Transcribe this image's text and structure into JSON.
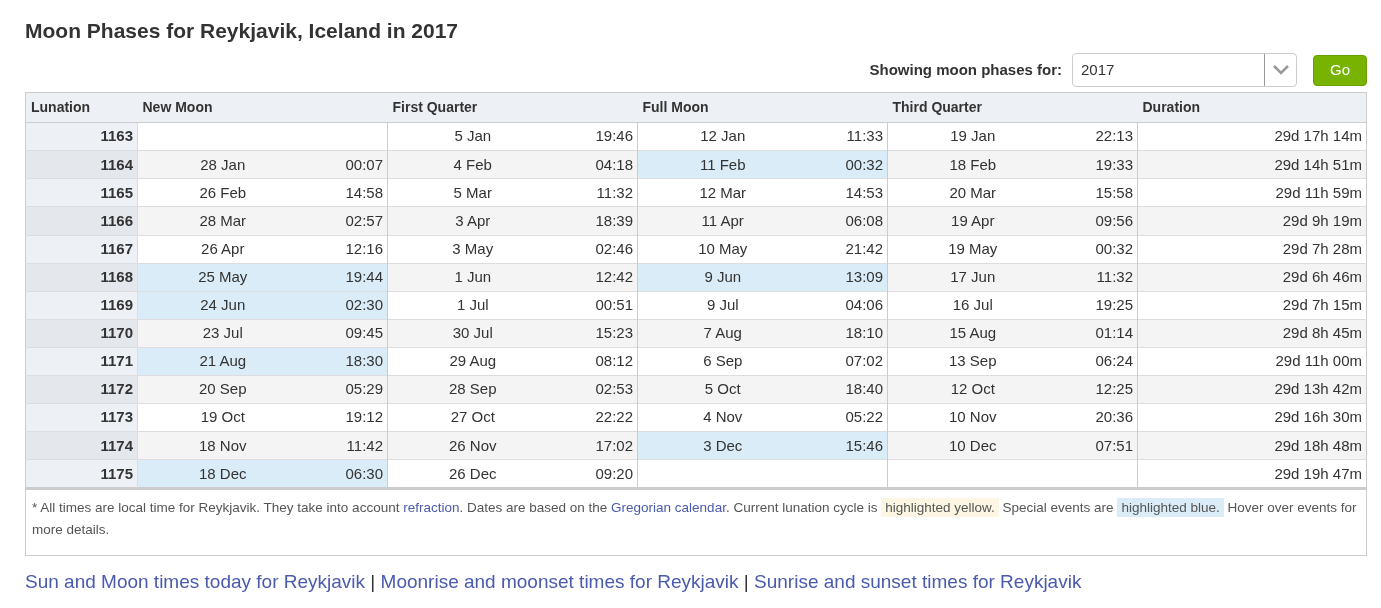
{
  "title": "Moon Phases for Reykjavik, Iceland in 2017",
  "selector": {
    "label": "Showing moon phases for:",
    "value": "2017",
    "button": "Go"
  },
  "table": {
    "columns": [
      {
        "label": "Lunation"
      },
      {
        "label": "New Moon"
      },
      {
        "label": "First Quarter"
      },
      {
        "label": "Full Moon"
      },
      {
        "label": "Third Quarter"
      },
      {
        "label": "Duration"
      }
    ],
    "rows": [
      {
        "lunation": "1163",
        "first_quarter": {
          "date": "5 Jan",
          "time": "19:46",
          "special": false
        },
        "full_moon": {
          "date": "12 Jan",
          "time": "11:33",
          "special": false
        },
        "third_quarter": {
          "date": "19 Jan",
          "time": "22:13",
          "special": false
        },
        "duration": "29d 17h 14m"
      },
      {
        "lunation": "1164",
        "new_moon": {
          "date": "28 Jan",
          "time": "00:07",
          "special": false
        },
        "first_quarter": {
          "date": "4 Feb",
          "time": "04:18",
          "special": false
        },
        "full_moon": {
          "date": "11 Feb",
          "time": "00:32",
          "special": true
        },
        "third_quarter": {
          "date": "18 Feb",
          "time": "19:33",
          "special": false
        },
        "duration": "29d 14h 51m"
      },
      {
        "lunation": "1165",
        "new_moon": {
          "date": "26 Feb",
          "time": "14:58",
          "special": false
        },
        "first_quarter": {
          "date": "5 Mar",
          "time": "11:32",
          "special": false
        },
        "full_moon": {
          "date": "12 Mar",
          "time": "14:53",
          "special": false
        },
        "third_quarter": {
          "date": "20 Mar",
          "time": "15:58",
          "special": false
        },
        "duration": "29d 11h 59m"
      },
      {
        "lunation": "1166",
        "new_moon": {
          "date": "28 Mar",
          "time": "02:57",
          "special": false
        },
        "first_quarter": {
          "date": "3 Apr",
          "time": "18:39",
          "special": false
        },
        "full_moon": {
          "date": "11 Apr",
          "time": "06:08",
          "special": false
        },
        "third_quarter": {
          "date": "19 Apr",
          "time": "09:56",
          "special": false
        },
        "duration": "29d 9h 19m"
      },
      {
        "lunation": "1167",
        "new_moon": {
          "date": "26 Apr",
          "time": "12:16",
          "special": false
        },
        "first_quarter": {
          "date": "3 May",
          "time": "02:46",
          "special": false
        },
        "full_moon": {
          "date": "10 May",
          "time": "21:42",
          "special": false
        },
        "third_quarter": {
          "date": "19 May",
          "time": "00:32",
          "special": false
        },
        "duration": "29d 7h 28m"
      },
      {
        "lunation": "1168",
        "new_moon": {
          "date": "25 May",
          "time": "19:44",
          "special": true
        },
        "first_quarter": {
          "date": "1 Jun",
          "time": "12:42",
          "special": false
        },
        "full_moon": {
          "date": "9 Jun",
          "time": "13:09",
          "special": true
        },
        "third_quarter": {
          "date": "17 Jun",
          "time": "11:32",
          "special": false
        },
        "duration": "29d 6h 46m"
      },
      {
        "lunation": "1169",
        "new_moon": {
          "date": "24 Jun",
          "time": "02:30",
          "special": true
        },
        "first_quarter": {
          "date": "1 Jul",
          "time": "00:51",
          "special": false
        },
        "full_moon": {
          "date": "9 Jul",
          "time": "04:06",
          "special": false
        },
        "third_quarter": {
          "date": "16 Jul",
          "time": "19:25",
          "special": false
        },
        "duration": "29d 7h 15m"
      },
      {
        "lunation": "1170",
        "new_moon": {
          "date": "23 Jul",
          "time": "09:45",
          "special": false
        },
        "first_quarter": {
          "date": "30 Jul",
          "time": "15:23",
          "special": false
        },
        "full_moon": {
          "date": "7 Aug",
          "time": "18:10",
          "special": false
        },
        "third_quarter": {
          "date": "15 Aug",
          "time": "01:14",
          "special": false
        },
        "duration": "29d 8h 45m"
      },
      {
        "lunation": "1171",
        "new_moon": {
          "date": "21 Aug",
          "time": "18:30",
          "special": true
        },
        "first_quarter": {
          "date": "29 Aug",
          "time": "08:12",
          "special": false
        },
        "full_moon": {
          "date": "6 Sep",
          "time": "07:02",
          "special": false
        },
        "third_quarter": {
          "date": "13 Sep",
          "time": "06:24",
          "special": false
        },
        "duration": "29d 11h 00m"
      },
      {
        "lunation": "1172",
        "new_moon": {
          "date": "20 Sep",
          "time": "05:29",
          "special": false
        },
        "first_quarter": {
          "date": "28 Sep",
          "time": "02:53",
          "special": false
        },
        "full_moon": {
          "date": "5 Oct",
          "time": "18:40",
          "special": false
        },
        "third_quarter": {
          "date": "12 Oct",
          "time": "12:25",
          "special": false
        },
        "duration": "29d 13h 42m"
      },
      {
        "lunation": "1173",
        "new_moon": {
          "date": "19 Oct",
          "time": "19:12",
          "special": false
        },
        "first_quarter": {
          "date": "27 Oct",
          "time": "22:22",
          "special": false
        },
        "full_moon": {
          "date": "4 Nov",
          "time": "05:22",
          "special": false
        },
        "third_quarter": {
          "date": "10 Nov",
          "time": "20:36",
          "special": false
        },
        "duration": "29d 16h 30m"
      },
      {
        "lunation": "1174",
        "new_moon": {
          "date": "18 Nov",
          "time": "11:42",
          "special": false
        },
        "first_quarter": {
          "date": "26 Nov",
          "time": "17:02",
          "special": false
        },
        "full_moon": {
          "date": "3 Dec",
          "time": "15:46",
          "special": true
        },
        "third_quarter": {
          "date": "10 Dec",
          "time": "07:51",
          "special": false
        },
        "duration": "29d 18h 48m"
      },
      {
        "lunation": "1175",
        "new_moon": {
          "date": "18 Dec",
          "time": "06:30",
          "special": true
        },
        "first_quarter": {
          "date": "26 Dec",
          "time": "09:20",
          "special": false
        },
        "duration": "29d 19h 47m"
      }
    ]
  },
  "note": [
    {
      "kind": "text",
      "text": "* All times are local time for Reykjavik. They take into account "
    },
    {
      "kind": "link",
      "text": "refraction"
    },
    {
      "kind": "text",
      "text": ". Dates are based on the "
    },
    {
      "kind": "link",
      "text": "Gregorian calendar"
    },
    {
      "kind": "text",
      "text": ". Current lunation cycle is "
    },
    {
      "kind": "highlight",
      "color": "#fdf6e3",
      "text": "highlighted yellow."
    },
    {
      "kind": "text",
      "text": " Special events are "
    },
    {
      "kind": "highlight",
      "color": "#d9ecf7",
      "text": "highlighted blue."
    },
    {
      "kind": "text",
      "text": " Hover over events for more details."
    }
  ],
  "footer_links": [
    {
      "kind": "link",
      "text": "Sun and Moon times today for Reykjavik"
    },
    {
      "kind": "separator",
      "text": "|"
    },
    {
      "kind": "link",
      "text": "Moonrise and moonset times for Reykjavik"
    },
    {
      "kind": "separator",
      "text": "|"
    },
    {
      "kind": "link",
      "text": "Sunrise and sunset times for Reykjavik"
    }
  ]
}
